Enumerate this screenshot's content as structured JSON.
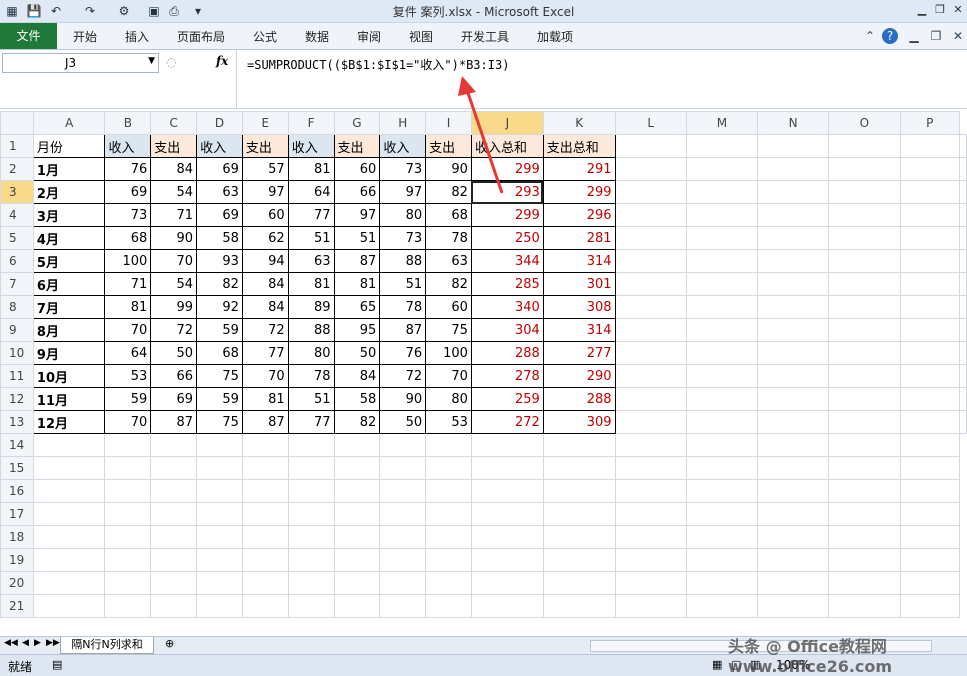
{
  "window": {
    "title": "复件 案列.xlsx - Microsoft Excel"
  },
  "ribbon": {
    "file_tab": "文件",
    "tabs": [
      "开始",
      "插入",
      "页面布局",
      "公式",
      "数据",
      "审阅",
      "视图",
      "开发工具",
      "加载项"
    ]
  },
  "formula_bar": {
    "name_box": "J3",
    "fx": "fx",
    "formula": "=SUMPRODUCT(($B$1:$I$1=\"收入\")*B3:I3)"
  },
  "columns": [
    "A",
    "B",
    "C",
    "D",
    "E",
    "F",
    "G",
    "H",
    "I",
    "J",
    "K",
    "L",
    "M",
    "N",
    "O",
    "P"
  ],
  "header_row": [
    "月份",
    "收入",
    "支出",
    "收入",
    "支出",
    "收入",
    "支出",
    "收入",
    "支出",
    "收入总和",
    "支出总和"
  ],
  "rows": [
    [
      "1月",
      "76",
      "84",
      "69",
      "57",
      "81",
      "60",
      "73",
      "90",
      "299",
      "291"
    ],
    [
      "2月",
      "69",
      "54",
      "63",
      "97",
      "64",
      "66",
      "97",
      "82",
      "293",
      "299"
    ],
    [
      "3月",
      "73",
      "71",
      "69",
      "60",
      "77",
      "97",
      "80",
      "68",
      "299",
      "296"
    ],
    [
      "4月",
      "68",
      "90",
      "58",
      "62",
      "51",
      "51",
      "73",
      "78",
      "250",
      "281"
    ],
    [
      "5月",
      "100",
      "70",
      "93",
      "94",
      "63",
      "87",
      "88",
      "63",
      "344",
      "314"
    ],
    [
      "6月",
      "71",
      "54",
      "82",
      "84",
      "81",
      "81",
      "51",
      "82",
      "285",
      "301"
    ],
    [
      "7月",
      "81",
      "99",
      "92",
      "84",
      "89",
      "65",
      "78",
      "60",
      "340",
      "308"
    ],
    [
      "8月",
      "70",
      "72",
      "59",
      "72",
      "88",
      "95",
      "87",
      "75",
      "304",
      "314"
    ],
    [
      "9月",
      "64",
      "50",
      "68",
      "77",
      "80",
      "50",
      "76",
      "100",
      "288",
      "277"
    ],
    [
      "10月",
      "53",
      "66",
      "75",
      "70",
      "78",
      "84",
      "72",
      "70",
      "278",
      "290"
    ],
    [
      "11月",
      "59",
      "69",
      "59",
      "81",
      "51",
      "58",
      "90",
      "80",
      "259",
      "288"
    ],
    [
      "12月",
      "70",
      "87",
      "75",
      "87",
      "77",
      "82",
      "50",
      "53",
      "272",
      "309"
    ]
  ],
  "empty_rows": [
    "14",
    "15",
    "16",
    "17",
    "18",
    "19",
    "20",
    "21"
  ],
  "sheet_tabs": [
    "隔N行N列求和"
  ],
  "status": {
    "ready": "就绪",
    "zoom": "100%",
    "watermark": "头条 @ Office教程网 www.office26.com"
  }
}
